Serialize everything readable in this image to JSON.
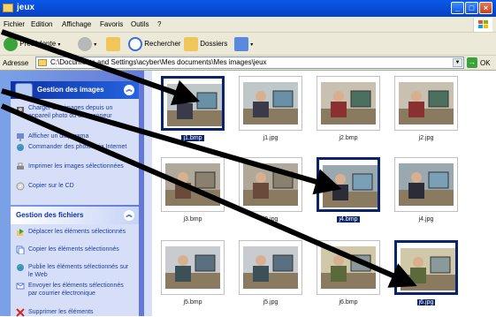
{
  "window": {
    "title": "jeux"
  },
  "menu": [
    "Fichier",
    "Edition",
    "Affichage",
    "Favoris",
    "Outils",
    "?"
  ],
  "toolbar": {
    "back_label": "Précédente",
    "search_label": "Rechercher",
    "folders_label": "Dossiers"
  },
  "address": {
    "label": "Adresse",
    "value": "C:\\Documents and Settings\\acyber\\Mes documents\\Mes images\\jeux",
    "go_label": "OK"
  },
  "tasks_panel": {
    "title": "Gestion des images",
    "items": [
      "Charger des images depuis un appareil photo ou un scanneur",
      "Afficher un diaporama",
      "Commander des photos via Internet",
      "Imprimer les images sélectionnées",
      "Copier sur le CD"
    ]
  },
  "files_panel": {
    "title": "Gestion des fichiers",
    "items": [
      "Déplacer les éléments sélectionnés",
      "Copier les éléments sélectionnés",
      "Publie les éléments sélectionnés sur le Web",
      "Envoyer les éléments sélectionnés par courrier électronique",
      "Supprimer les éléments"
    ]
  },
  "files": [
    {
      "name": "j1.bmp",
      "selected": true,
      "scene": "office"
    },
    {
      "name": "j1.jpg",
      "selected": false,
      "scene": "office"
    },
    {
      "name": "j2.bmp",
      "selected": false,
      "scene": "screen"
    },
    {
      "name": "j2.jpg",
      "selected": false,
      "scene": "screen"
    },
    {
      "name": "j3.bmp",
      "selected": false,
      "scene": "room"
    },
    {
      "name": "j3.jpg",
      "selected": false,
      "scene": "room"
    },
    {
      "name": "j4.bmp",
      "selected": true,
      "scene": "back"
    },
    {
      "name": "j4.jpg",
      "selected": false,
      "scene": "back"
    },
    {
      "name": "j5.bmp",
      "selected": false,
      "scene": "group"
    },
    {
      "name": "j5.jpg",
      "selected": false,
      "scene": "group"
    },
    {
      "name": "j6.bmp",
      "selected": false,
      "scene": "desk"
    },
    {
      "name": "j6.jpg",
      "selected": true,
      "scene": "desk"
    }
  ]
}
